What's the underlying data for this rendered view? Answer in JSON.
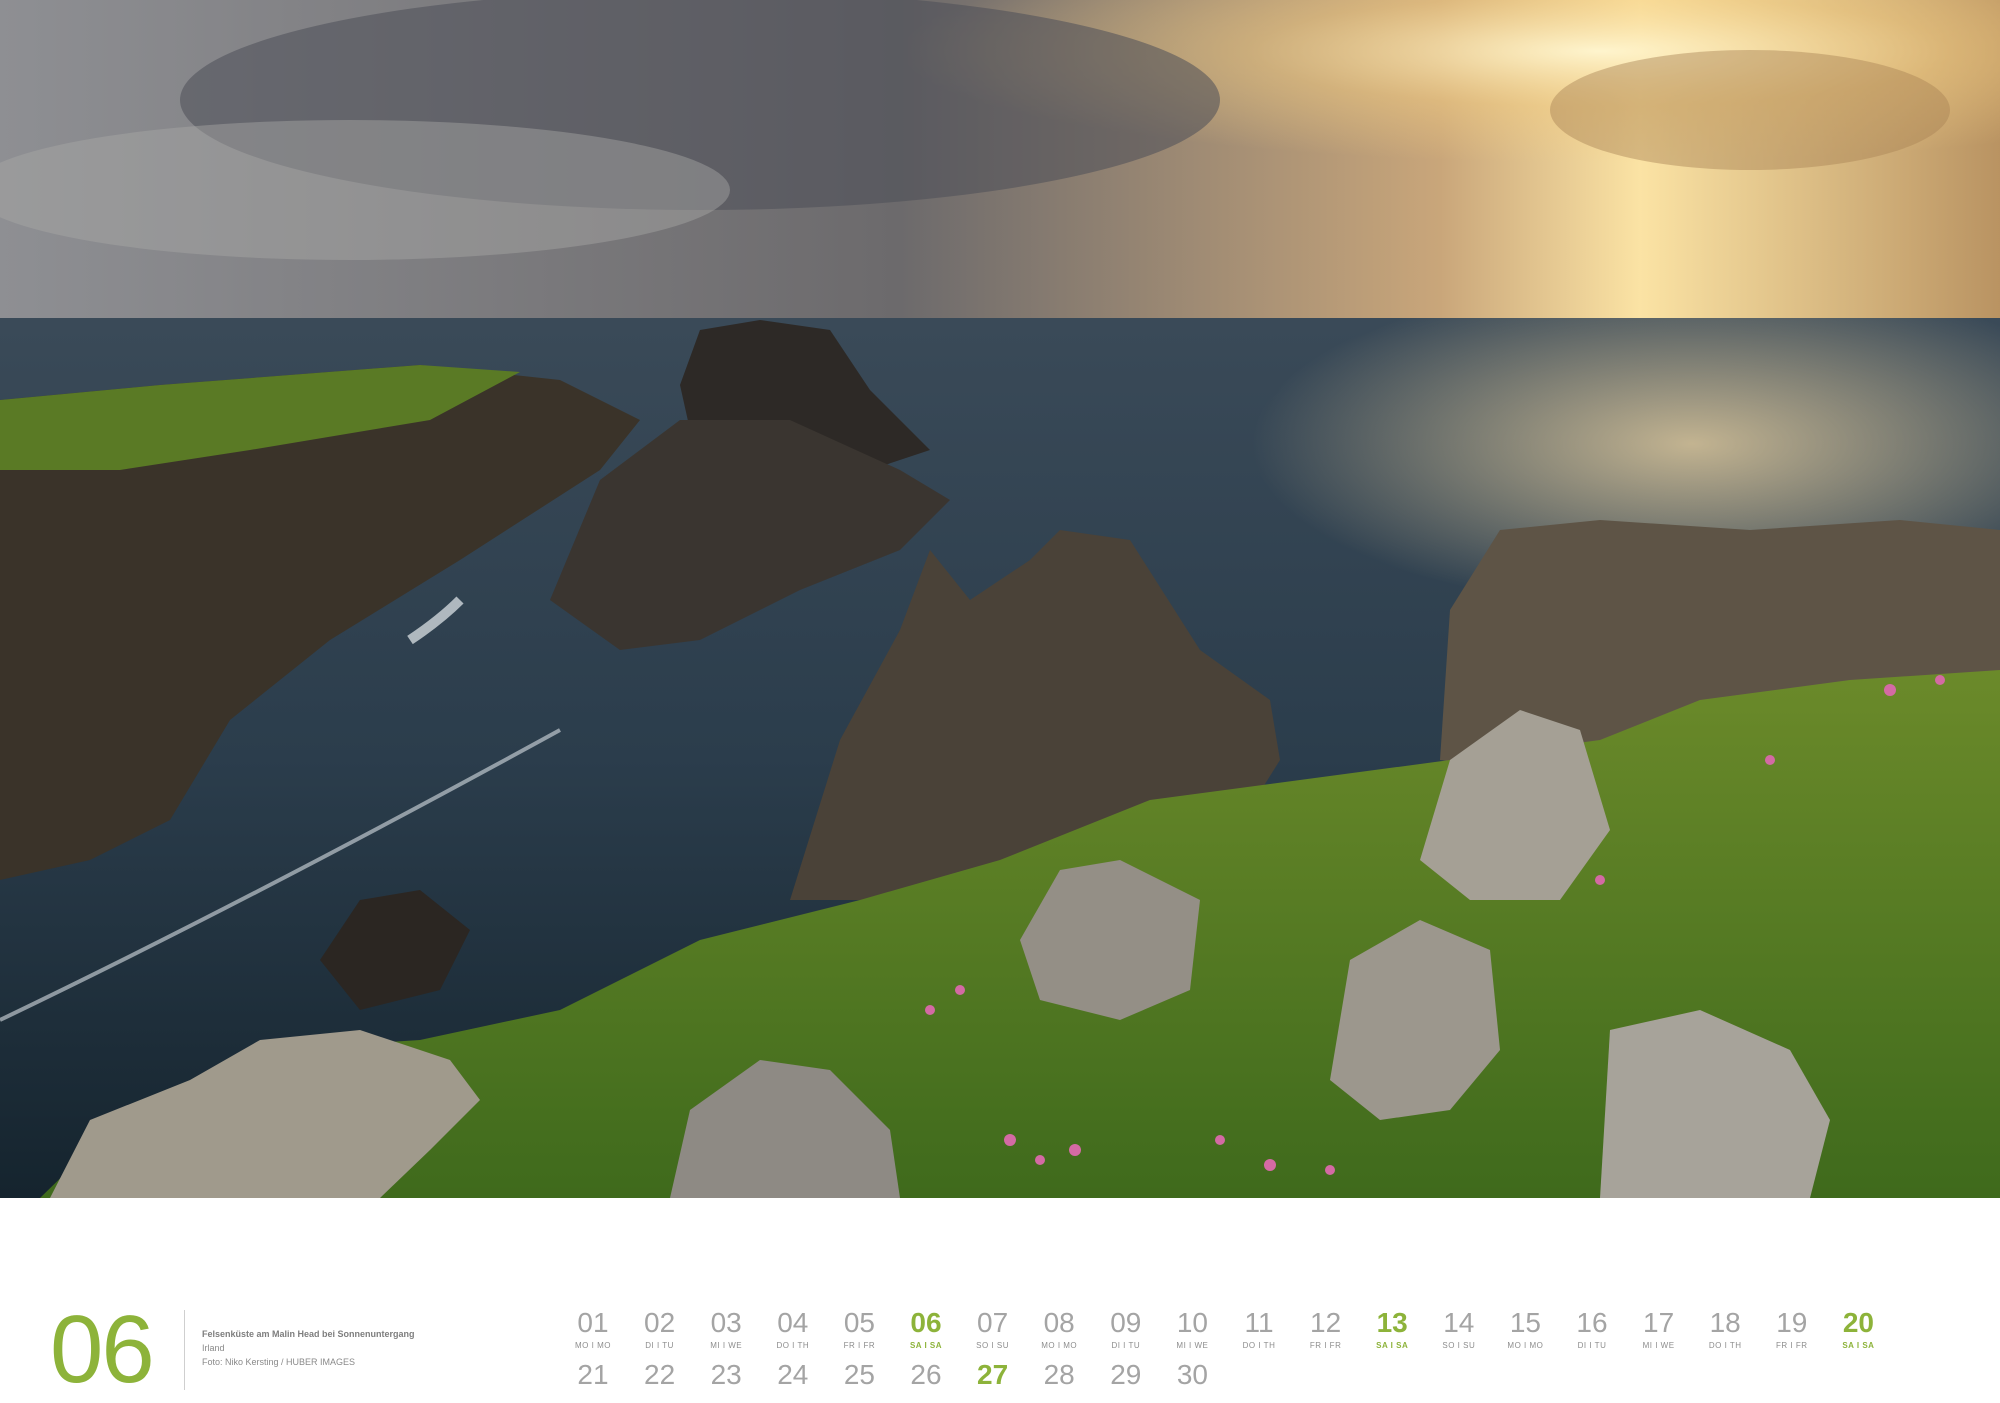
{
  "month": {
    "number": "06",
    "caption_title": "Felsenküste am Malin Head bei Sonnenuntergang",
    "caption_location": "Irland",
    "caption_credit": "Foto: Niko Kersting / HUBER IMAGES"
  },
  "days_row1": [
    {
      "num": "01",
      "wd": "MO I MO"
    },
    {
      "num": "02",
      "wd": "DI I TU"
    },
    {
      "num": "03",
      "wd": "MI I WE"
    },
    {
      "num": "04",
      "wd": "DO I TH"
    },
    {
      "num": "05",
      "wd": "FR I FR"
    },
    {
      "num": "06",
      "wd": "SA I SA"
    },
    {
      "num": "07",
      "wd": "SO I SU"
    },
    {
      "num": "08",
      "wd": "MO I MO"
    },
    {
      "num": "09",
      "wd": "DI I TU"
    },
    {
      "num": "10",
      "wd": "MI I WE"
    },
    {
      "num": "11",
      "wd": "DO I TH"
    },
    {
      "num": "12",
      "wd": "FR I FR"
    },
    {
      "num": "13",
      "wd": "SA I SA"
    },
    {
      "num": "14",
      "wd": "SO I SU"
    },
    {
      "num": "15",
      "wd": "MO I MO"
    },
    {
      "num": "16",
      "wd": "DI I TU"
    },
    {
      "num": "17",
      "wd": "MI I WE"
    },
    {
      "num": "18",
      "wd": "DO I TH"
    },
    {
      "num": "19",
      "wd": "FR I FR"
    },
    {
      "num": "20",
      "wd": "SA I SA"
    }
  ],
  "days_row1_display": [
    {
      "num": "01",
      "wd": "MO I MO"
    },
    {
      "num": "02",
      "wd": "DI I TU"
    },
    {
      "num": "03",
      "wd": "MI I WE"
    },
    {
      "num": "04",
      "wd": "DO I TH"
    },
    {
      "num": "05",
      "wd": "FR I FR"
    },
    {
      "num": "06",
      "wd": "SA I SA"
    },
    {
      "num": "07",
      "wd": "SO I SU"
    },
    {
      "num": "08",
      "wd": "MO I MO"
    },
    {
      "num": "09",
      "wd": "DI I TU"
    },
    {
      "num": "10",
      "wd": "MI I WE"
    },
    {
      "num": "11",
      "wd": "DO I TH"
    },
    {
      "num": "12",
      "wd": "FR I FR"
    },
    {
      "num": "13",
      "wd": "SA I SA"
    },
    {
      "num": "14",
      "wd": "SO I SU"
    },
    {
      "num": "15",
      "wd": "MO I MO"
    },
    {
      "num": "16",
      "wd": "DI I TU"
    },
    {
      "num": "17",
      "wd": "MI I WE"
    },
    {
      "num": "18",
      "wd": "DO I TH"
    },
    {
      "num": "19",
      "wd": "FR I FR"
    },
    {
      "num": "20",
      "wd": "SA I SA"
    }
  ],
  "days_row2": [
    {
      "num": "21"
    },
    {
      "num": "22"
    },
    {
      "num": "23"
    },
    {
      "num": "24"
    },
    {
      "num": "25"
    },
    {
      "num": "26"
    },
    {
      "num": "27"
    },
    {
      "num": "28"
    },
    {
      "num": "29"
    },
    {
      "num": "30"
    }
  ],
  "colors": {
    "accent": "#8db33a",
    "text": "#a4a4a4"
  }
}
